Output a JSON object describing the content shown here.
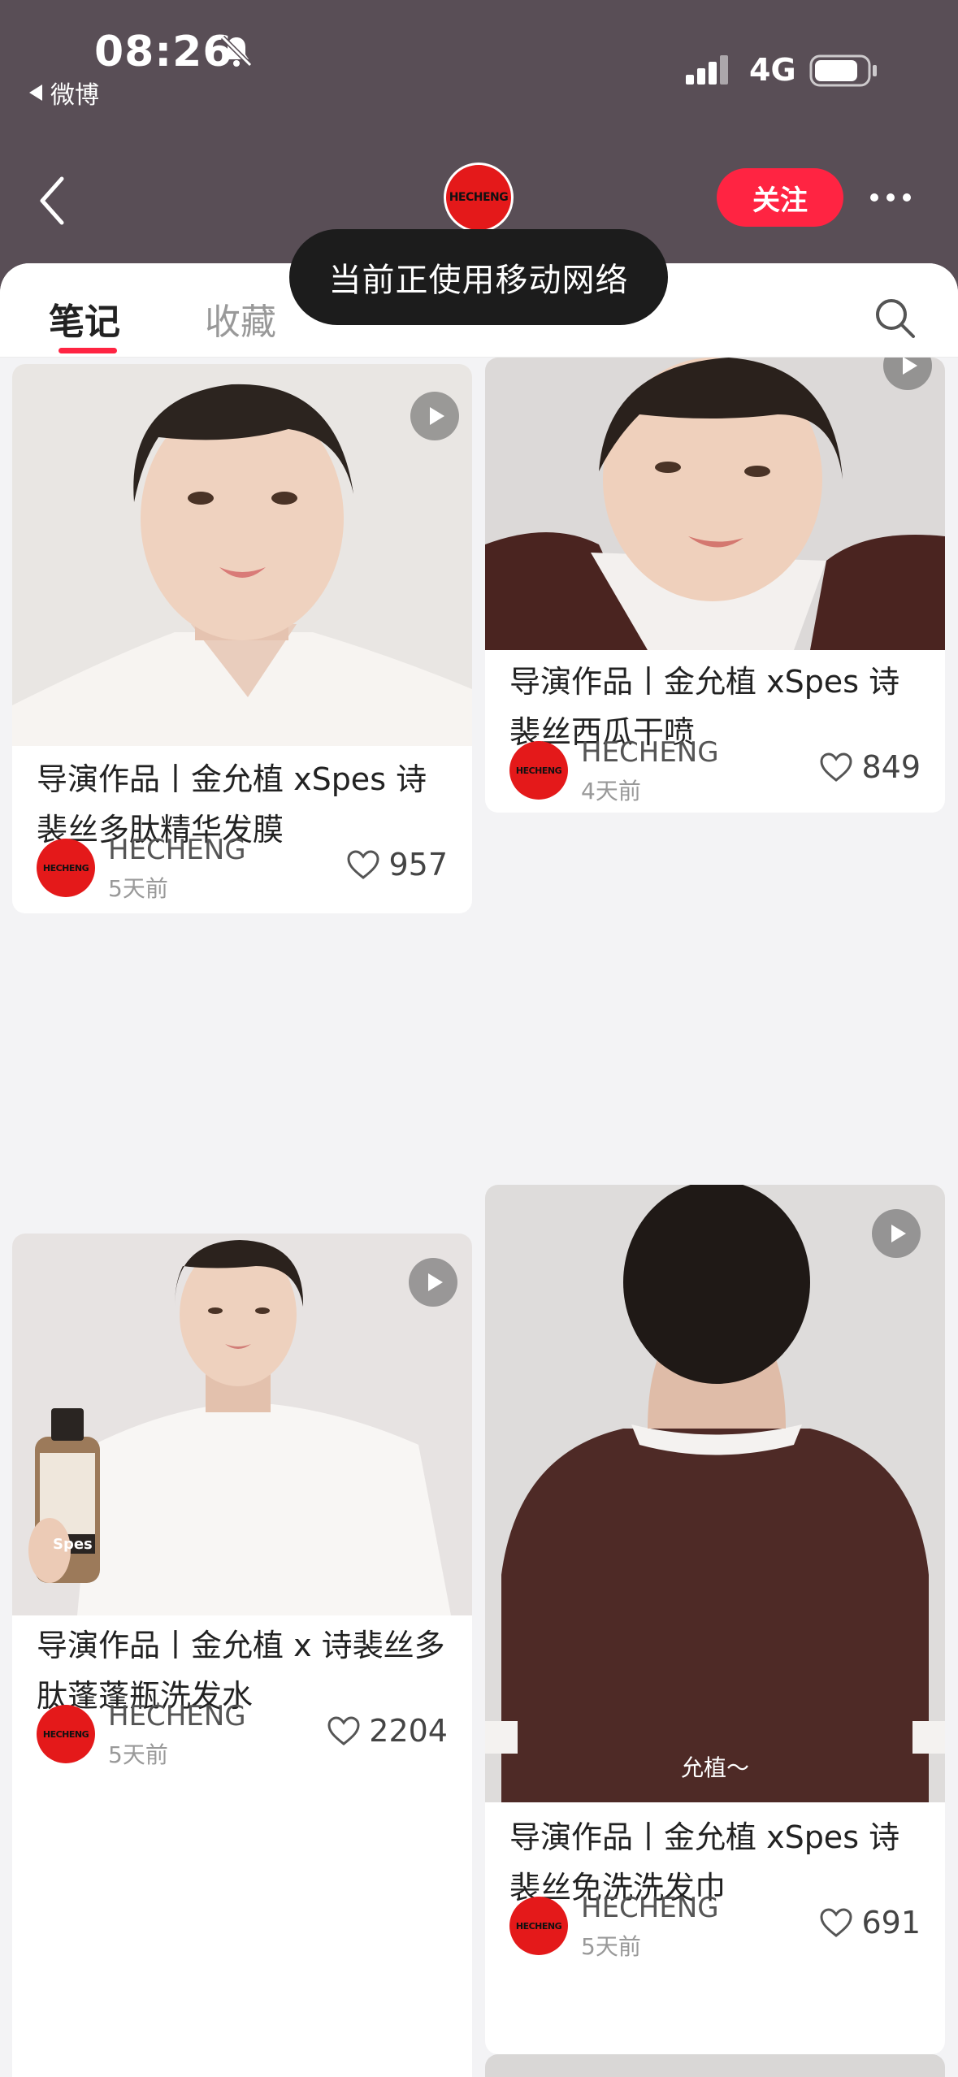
{
  "status_bar": {
    "time": "08:26",
    "back_app": "微博",
    "network": "4G"
  },
  "header": {
    "brand_avatar_text": "HECHENG",
    "follow_label": "关注"
  },
  "tabs": [
    {
      "label": "笔记",
      "active": true
    },
    {
      "label": "收藏",
      "active": false
    }
  ],
  "toast": "当前正使用移动网络",
  "notes": [
    {
      "title": "导演作品丨金允植 xSpes 诗裴丝多肽精华发膜",
      "author": "HECHENG",
      "avatar_text": "HECHENG",
      "date": "5天前",
      "likes": "957",
      "is_video": true
    },
    {
      "title": "导演作品丨金允植 xSpes 诗裴丝西瓜干喷",
      "author": "HECHENG",
      "avatar_text": "HECHENG",
      "date": "4天前",
      "likes": "849",
      "is_video": true
    },
    {
      "title": "导演作品丨金允植 x 诗裴丝多肽蓬蓬瓶洗发水",
      "author": "HECHENG",
      "avatar_text": "HECHENG",
      "date": "5天前",
      "likes": "2204",
      "is_video": true,
      "bottle_label": "Spes"
    },
    {
      "title": "导演作品丨金允植 xSpes 诗裴丝免洗洗发巾",
      "author": "HECHENG",
      "avatar_text": "HECHENG",
      "date": "5天前",
      "likes": "691",
      "is_video": true,
      "caption": "允植～"
    }
  ],
  "colors": {
    "header_bg": "#594e56",
    "accent": "#ff2442",
    "brand_red": "#e4191a"
  }
}
